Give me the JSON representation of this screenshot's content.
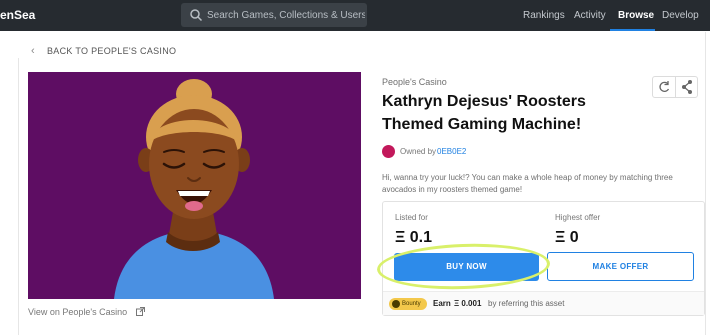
{
  "nav": {
    "brand": "enSea",
    "search_placeholder": "Search Games, Collections & Users",
    "links": [
      "Rankings",
      "Activity",
      "Browse",
      "Develop"
    ],
    "active_link": "Browse"
  },
  "back_link": "BACK TO PEOPLE'S CASINO",
  "asset": {
    "collection": "People's Casino",
    "title": "Kathryn Dejesus' Roosters Themed Gaming Machine!",
    "owned_by_label": "Owned by",
    "owner": "0EB0E2",
    "description": "Hi, wanna try your luck!? You can make a whole heap of money by matching three avocados in my roosters themed game!",
    "image_bg": "#5e0d63",
    "view_link": "View on People's Casino"
  },
  "pricing": {
    "listed_label": "Listed for",
    "listed_value": "Ξ 0.1",
    "highest_label": "Highest offer",
    "highest_value": "Ξ 0",
    "buy_label": "BUY NOW",
    "offer_label": "MAKE OFFER",
    "bounty_badge": "Bounty",
    "earn_label": "Earn",
    "earn_amount": "Ξ 0.001",
    "earn_suffix": "by referring this asset"
  },
  "icons": {
    "search": "search-icon",
    "refresh": "refresh-icon",
    "share": "share-icon",
    "external": "external-link-icon",
    "back": "chevron-left-icon"
  },
  "colors": {
    "accent": "#2081e2",
    "buy_button": "#2d8bea",
    "highlight": "#d9f06a",
    "topbar": "#262b30"
  }
}
